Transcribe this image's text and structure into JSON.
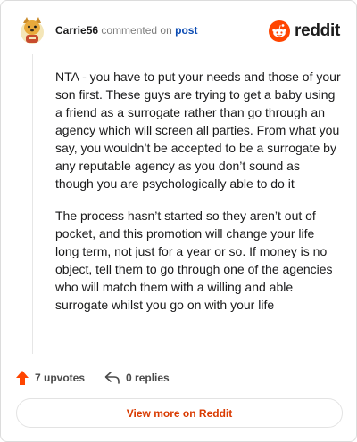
{
  "header": {
    "author": "Carrie56",
    "action": "commented on",
    "target": "post",
    "brand": "reddit"
  },
  "comment": {
    "paragraphs": [
      "NTA - you have to put your needs and those of your son first. These guys are trying to get a baby using a friend as a surrogate rather than go through an agency which will screen all parties. From what you say, you wouldn’t be accepted to be a surrogate by any reputable agency as you don’t sound as though you are psychologically able to do it",
      "The process hasn’t started so they aren’t out of pocket, and this promotion will change your life long term, not just for a year or so. If money is no object, tell them to go through one of the agencies who will match them with a willing and able surrogate whilst you go on with your life"
    ]
  },
  "footer": {
    "upvotes": "7 upvotes",
    "replies": "0 replies",
    "view_more": "View more on Reddit"
  },
  "colors": {
    "brand": "#ff4500",
    "link": "#0b4bb3",
    "upvote": "#ff4500"
  },
  "icons": {
    "avatar": "dog-avatar-icon",
    "brand_logo": "reddit-snoo-icon",
    "upvote": "upvote-arrow-icon",
    "reply": "reply-arrow-icon"
  }
}
